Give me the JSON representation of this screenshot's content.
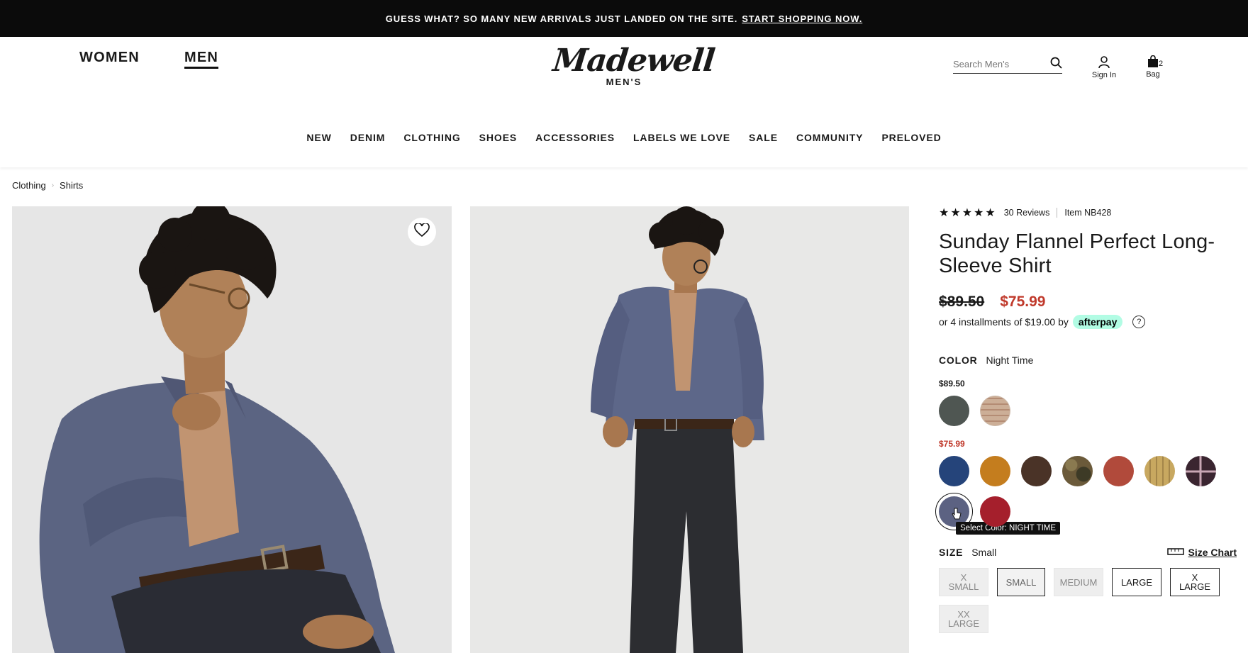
{
  "promo": {
    "text": "GUESS WHAT? SO MANY NEW ARRIVALS JUST LANDED ON THE SITE.",
    "link": "START SHOPPING NOW."
  },
  "header": {
    "women": "WOMEN",
    "men": "MEN",
    "logo": "Madewell",
    "logo_sub": "MEN'S",
    "search_placeholder": "Search Men's",
    "signin": "Sign In",
    "bag": "Bag",
    "bag_count": "2"
  },
  "nav": [
    "NEW",
    "DENIM",
    "CLOTHING",
    "SHOES",
    "ACCESSORIES",
    "LABELS WE LOVE",
    "SALE",
    "COMMUNITY",
    "PRELOVED"
  ],
  "breadcrumb": [
    "Clothing",
    "Shirts"
  ],
  "product": {
    "stars": "★★★★★",
    "reviews": "30 Reviews",
    "item": "Item NB428",
    "title": "Sunday Flannel Perfect Long-Sleeve Shirt",
    "old_price": "$89.50",
    "new_price": "$75.99",
    "installments_text": "or 4 installments of $19.00 by",
    "afterpay": "afterpay",
    "color_label": "COLOR",
    "color_value": "Night Time",
    "group_full_price": "$89.50",
    "group_sale_price": "$75.99",
    "tooltip": "Select Color: NIGHT TIME",
    "size_label": "SIZE",
    "size_value": "Small",
    "size_chart": "Size Chart",
    "sizes": [
      "X SMALL",
      "SMALL",
      "MEDIUM",
      "LARGE",
      "X LARGE",
      "XX LARGE"
    ]
  },
  "colors": {
    "full_price": [
      "#4f5652",
      "#e4d3c4"
    ],
    "sale_row1": [
      "#25447a",
      "#c47d1e",
      "#4a3327",
      "#6b5a3a",
      "#b14a3b",
      "#c8a860",
      "#3a2530"
    ],
    "sale_row2": [
      "#5c6282",
      "#a51f2c"
    ],
    "sale_price": "#c0392b",
    "afterpay": "#b2fce4"
  }
}
